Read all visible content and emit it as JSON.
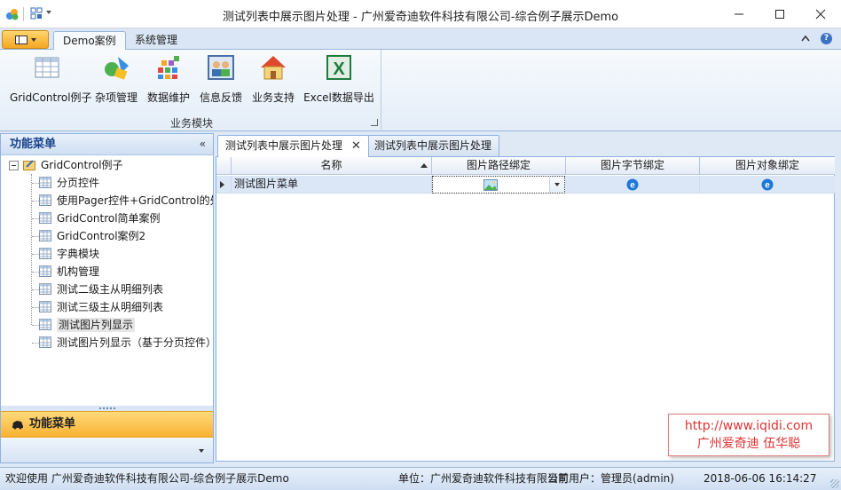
{
  "window": {
    "title": "测试列表中展示图片处理 - 广州爱奇迪软件科技有限公司-综合例子展示Demo"
  },
  "ribbon": {
    "tabs": [
      {
        "label": "Demo案例",
        "active": true
      },
      {
        "label": "系统管理",
        "active": false
      }
    ],
    "group_label": "业务模块",
    "buttons": [
      {
        "label": "GridControl例子",
        "icon": "grid-table-icon"
      },
      {
        "label": "杂项管理",
        "icon": "shapes-icon"
      },
      {
        "label": "数据维护",
        "icon": "data-blocks-icon"
      },
      {
        "label": "信息反馈",
        "icon": "people-feedback-icon"
      },
      {
        "label": "业务支持",
        "icon": "house-icon"
      },
      {
        "label": "Excel数据导出",
        "icon": "excel-icon"
      }
    ]
  },
  "left_panel": {
    "header": "功能菜单",
    "collapse_glyph": "«",
    "tree": {
      "root": "GridControl例子",
      "children": [
        "分页控件",
        "使用Pager控件+GridControl的处",
        "GridControl简单案例",
        "GridControl案例2",
        "字典模块",
        "机构管理",
        "测试二级主从明细列表",
        "测试三级主从明细列表",
        "测试图片列显示",
        "测试图片列显示（基于分页控件）"
      ],
      "selected_index": 8
    },
    "nav_group": "功能菜单"
  },
  "documents": {
    "tabs": [
      {
        "label": "测试列表中展示图片处理",
        "active": true,
        "close": "✕"
      },
      {
        "label": "测试列表中展示图片处理",
        "active": false
      }
    ]
  },
  "grid": {
    "columns": [
      "名称",
      "图片路径绑定",
      "图片字节绑定",
      "图片对象绑定"
    ],
    "rows": [
      {
        "name": "测试图片菜单"
      }
    ]
  },
  "watermark": {
    "line1": "http://www.iqidi.com",
    "line2": "广州爱奇迪 伍华聪"
  },
  "status": {
    "welcome": "欢迎使用 广州爱奇迪软件科技有限公司-综合例子展示Demo",
    "unit": "单位：广州爱奇迪软件科技有限公司",
    "user": "当前用户：管理员(admin)",
    "time": "2018-06-06 16:14:27"
  }
}
